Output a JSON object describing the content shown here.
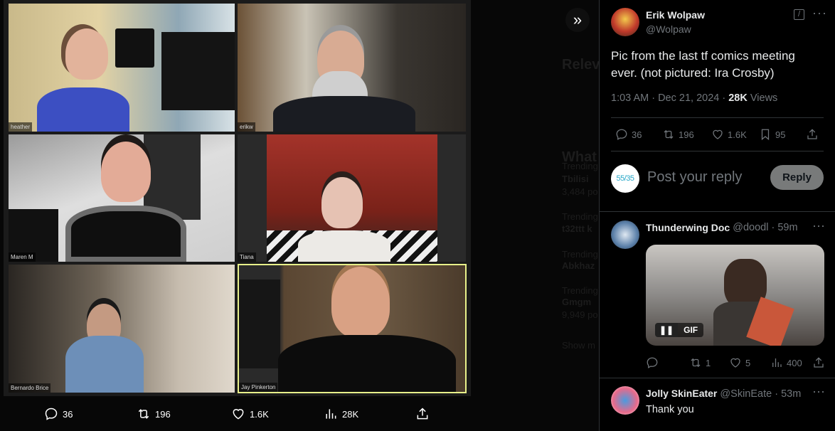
{
  "photo": {
    "participants": [
      "heather",
      "erikw",
      "Maren M",
      "Tiana",
      "Bernardo Brice",
      "Jay Pinkerton"
    ],
    "active_speaker_color": "#e8f08a"
  },
  "background_ghost": [
    "Relev",
    "What",
    "Trending",
    "Tbilisi",
    "3,484 po",
    "Trending",
    "t32ttt k",
    "Trending",
    "Abkhaz",
    "Trending",
    "Gmgm",
    "9,949 po",
    "Show m"
  ],
  "media_bar": {
    "replies": "36",
    "reposts": "196",
    "likes": "1.6K",
    "views": "28K"
  },
  "expand_icon": "chevron-double-right-icon",
  "tweet": {
    "author": "Erik Wolpaw",
    "handle": "@Wolpaw",
    "text_line1": "Pic from the last tf comics meeting",
    "text_line2": "ever. (not pictured: Ira Crosby)",
    "time": "1:03 AM · Dec 21, 2024 · ",
    "views_count": "28K",
    "views_label": " Views",
    "replies": "36",
    "reposts": "196",
    "likes": "1.6K",
    "bookmarks": "95"
  },
  "composer": {
    "avatar_text": "55/35",
    "placeholder": "Post your reply",
    "reply_button": "Reply"
  },
  "replies": [
    {
      "name": "Thunderwing Doc",
      "handle": "@doodl",
      "time": " · 59m",
      "gif_label": "GIF",
      "reposts": "1",
      "likes": "5",
      "views": "400"
    },
    {
      "name": "Jolly SkinEater",
      "handle": "@SkinEate",
      "time": " · 53m",
      "text": "Thank you"
    }
  ],
  "colors": {
    "bg": "#000000",
    "border": "#2f3336",
    "muted": "#71767b",
    "reply_button": "#787a7a"
  }
}
